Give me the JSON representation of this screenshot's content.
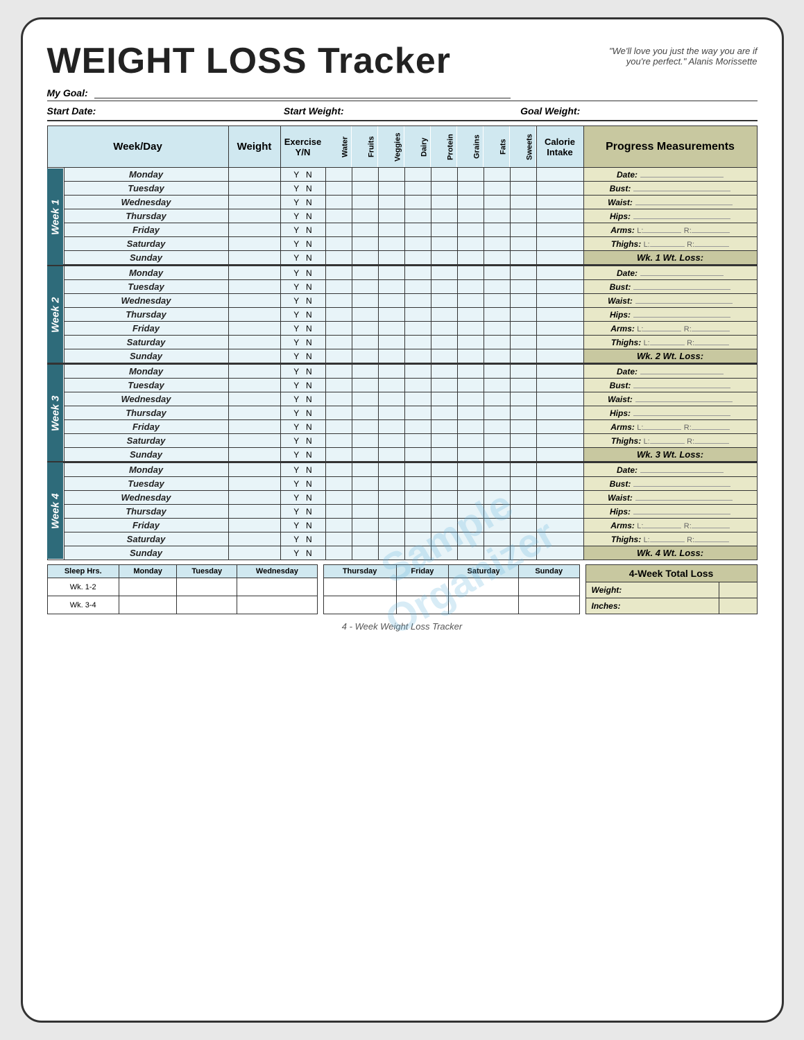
{
  "title": "WEIGHT LOSS Tracker",
  "quote": "\"We'll love you just the way you are if you're perfect.\" Alanis Morissette",
  "goal_label": "My Goal:",
  "start_date_label": "Start Date:",
  "start_weight_label": "Start Weight:",
  "goal_weight_label": "Goal Weight:",
  "header": {
    "weekday": "Week/Day",
    "weight": "Weight",
    "exercise": "Exercise Y/N",
    "nutrition_cols": [
      "Water",
      "Fruits",
      "Veggies",
      "Dairy",
      "Protein",
      "Grains",
      "Fats",
      "Sweets"
    ],
    "calorie": "Calorie Intake",
    "progress": "Progress Measurements"
  },
  "weeks": [
    {
      "label": "Week 1",
      "days": [
        "Monday",
        "Tuesday",
        "Wednesday",
        "Thursday",
        "Friday",
        "Saturday",
        "Sunday"
      ],
      "progress": {
        "date": "Date:",
        "bust": "Bust:",
        "waist": "Waist:",
        "hips": "Hips:",
        "arms": "Arms:",
        "arms_l": "L:",
        "arms_r": "R:",
        "thighs": "Thighs:",
        "thighs_l": "L:",
        "thighs_r": "R:",
        "loss": "Wk. 1 Wt. Loss:"
      }
    },
    {
      "label": "Week 2",
      "days": [
        "Monday",
        "Tuesday",
        "Wednesday",
        "Thursday",
        "Friday",
        "Saturday",
        "Sunday"
      ],
      "progress": {
        "date": "Date:",
        "bust": "Bust:",
        "waist": "Waist:",
        "hips": "Hips:",
        "arms": "Arms:",
        "arms_l": "L:",
        "arms_r": "R:",
        "thighs": "Thighs:",
        "thighs_l": "L:",
        "thighs_r": "R:",
        "loss": "Wk. 2 Wt. Loss:"
      }
    },
    {
      "label": "Week 3",
      "days": [
        "Monday",
        "Tuesday",
        "Wednesday",
        "Thursday",
        "Friday",
        "Saturday",
        "Sunday"
      ],
      "progress": {
        "date": "Date:",
        "bust": "Bust:",
        "waist": "Waist:",
        "hips": "Hips:",
        "arms": "Arms:",
        "arms_l": "L:",
        "arms_r": "R:",
        "thighs": "Thighs:",
        "thighs_l": "L:",
        "thighs_r": "R:",
        "loss": "Wk. 3 Wt. Loss:"
      }
    },
    {
      "label": "Week 4",
      "days": [
        "Monday",
        "Tuesday",
        "Wednesday",
        "Thursday",
        "Friday",
        "Saturday",
        "Sunday"
      ],
      "progress": {
        "date": "Date:",
        "bust": "Bust:",
        "waist": "Waist:",
        "hips": "Hips:",
        "arms": "Arms:",
        "arms_l": "L:",
        "arms_r": "R:",
        "thighs": "Thighs:",
        "thighs_l": "L:",
        "thighs_r": "R:",
        "loss": "Wk. 4 Wt. Loss:"
      }
    }
  ],
  "sleep": {
    "label": "Sleep Hrs.",
    "rows": [
      "Wk. 1-2",
      "Wk. 3-4"
    ],
    "days_left": [
      "Monday",
      "Tuesday",
      "Wednesday"
    ],
    "days_right": [
      "Thursday",
      "Friday",
      "Saturday",
      "Sunday"
    ]
  },
  "total_loss": {
    "header": "4-Week Total Loss",
    "weight_label": "Weight:",
    "inches_label": "Inches:"
  },
  "footer": "4 - Week Weight Loss Tracker",
  "watermark_line1": "Sample",
  "watermark_line2": "Organizer"
}
